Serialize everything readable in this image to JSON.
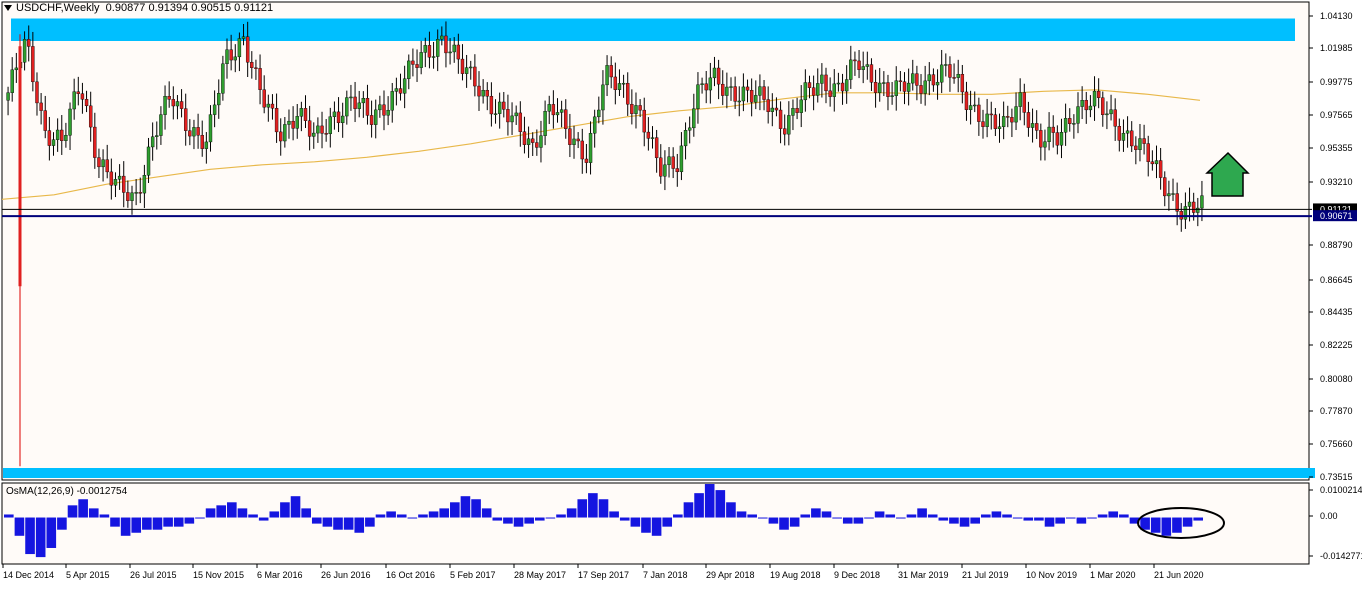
{
  "window": {
    "symbol_title": "USDCHF,Weekly",
    "ohlc": "0.90877 0.91394 0.90515 0.91121"
  },
  "indicator": {
    "label": "OsMA(12,26,9) -0.0012754",
    "ticks": [
      "0.0100214",
      "0.00",
      "-0.0142771"
    ]
  },
  "chart_data": [
    {
      "type": "candlestick",
      "title": "USDCHF,Weekly",
      "ylim": [
        0.7335,
        1.0455
      ],
      "y_ticks": [
        "1.04130",
        "1.01985",
        "0.99775",
        "0.97565",
        "0.95355",
        "0.93210",
        "0.91121",
        "0.88790",
        "0.86645",
        "0.84435",
        "0.82225",
        "0.80080",
        "0.77870",
        "0.75660",
        "0.73515"
      ],
      "price_labels": {
        "current": "0.91121",
        "support": "0.90671"
      },
      "x_tick_labels": [
        "14 Dec 2014",
        "5 Apr 2015",
        "26 Jul 2015",
        "15 Nov 2015",
        "6 Mar 2016",
        "26 Jun 2016",
        "16 Oct 2016",
        "5 Feb 2017",
        "28 May 2017",
        "17 Sep 2017",
        "7 Jan 2018",
        "29 Apr 2018",
        "19 Aug 2018",
        "9 Dec 2018",
        "31 Mar 2019",
        "21 Jul 2019",
        "10 Nov 2019",
        "1 Mar 2020",
        "21 Jun 2020"
      ],
      "closes_sampled": [
        0.989,
        1.021,
        0.966,
        0.955,
        0.995,
        0.945,
        0.925,
        0.918,
        0.96,
        0.985,
        0.968,
        0.955,
        1.01,
        1.028,
        0.985,
        0.962,
        0.978,
        0.955,
        0.975,
        0.985,
        0.97,
        0.985,
        0.998,
        1.015,
        1.027,
        1.005,
        0.995,
        0.978,
        0.968,
        0.955,
        0.98,
        0.96,
        0.95,
        0.998,
        0.992,
        0.975,
        0.935,
        0.945,
        0.985,
        0.998,
        0.992,
        0.985,
        0.983,
        0.968,
        0.985,
        0.998,
        0.992,
        1.008,
        0.998,
        0.988,
        0.995,
        1.0,
        1.002,
        0.985,
        0.972,
        0.963,
        0.988,
        0.955,
        0.958,
        0.98,
        0.982,
        0.972,
        0.96,
        0.945,
        0.928,
        0.908,
        0.912
      ],
      "moving_average": [
        0.918,
        0.921,
        0.928,
        0.933,
        0.938,
        0.941,
        0.943,
        0.946,
        0.95,
        0.955,
        0.961,
        0.967,
        0.973,
        0.977,
        0.98,
        0.985,
        0.989,
        0.989,
        0.988,
        0.988,
        0.99,
        0.991,
        0.988,
        0.984
      ],
      "horizontal_lines": [
        0.91121,
        0.90671
      ],
      "resistance_zone": [
        1.0235,
        1.0385
      ],
      "support_zone": [
        0.7345,
        0.7405
      ],
      "annotation": "up-arrow"
    },
    {
      "type": "bar",
      "title": "OsMA(12,26,9) -0.0012754",
      "ylim": [
        -0.0142771,
        0.0100214
      ],
      "values": [
        0.001,
        -0.006,
        -0.012,
        -0.013,
        -0.01,
        -0.004,
        0.004,
        0.006,
        0.003,
        0.001,
        -0.003,
        -0.006,
        -0.005,
        -0.004,
        -0.004,
        -0.003,
        -0.003,
        -0.002,
        0.0,
        0.003,
        0.004,
        0.005,
        0.003,
        0.001,
        -0.001,
        0.002,
        0.005,
        0.007,
        0.003,
        -0.002,
        -0.003,
        -0.004,
        -0.004,
        -0.005,
        -0.003,
        0.001,
        0.002,
        0.001,
        0.0,
        0.001,
        0.002,
        0.003,
        0.005,
        0.007,
        0.006,
        0.003,
        -0.001,
        -0.002,
        -0.003,
        -0.002,
        -0.001,
        0.0,
        0.001,
        0.003,
        0.006,
        0.008,
        0.006,
        0.002,
        -0.001,
        -0.003,
        -0.005,
        -0.006,
        -0.003,
        0.001,
        0.005,
        0.008,
        0.011,
        0.009,
        0.005,
        0.002,
        0.001,
        0.0,
        -0.002,
        -0.004,
        -0.003,
        0.001,
        0.003,
        0.002,
        0.0,
        -0.002,
        -0.002,
        0.0,
        0.002,
        0.001,
        0.0,
        0.001,
        0.003,
        0.001,
        -0.001,
        -0.002,
        -0.003,
        -0.002,
        0.001,
        0.002,
        0.001,
        0.0,
        -0.001,
        -0.001,
        -0.003,
        -0.002,
        0.0,
        -0.002,
        0.0,
        0.001,
        0.002,
        0.001,
        -0.002,
        -0.004,
        -0.005,
        -0.006,
        -0.005,
        -0.003,
        -0.001
      ]
    }
  ]
}
